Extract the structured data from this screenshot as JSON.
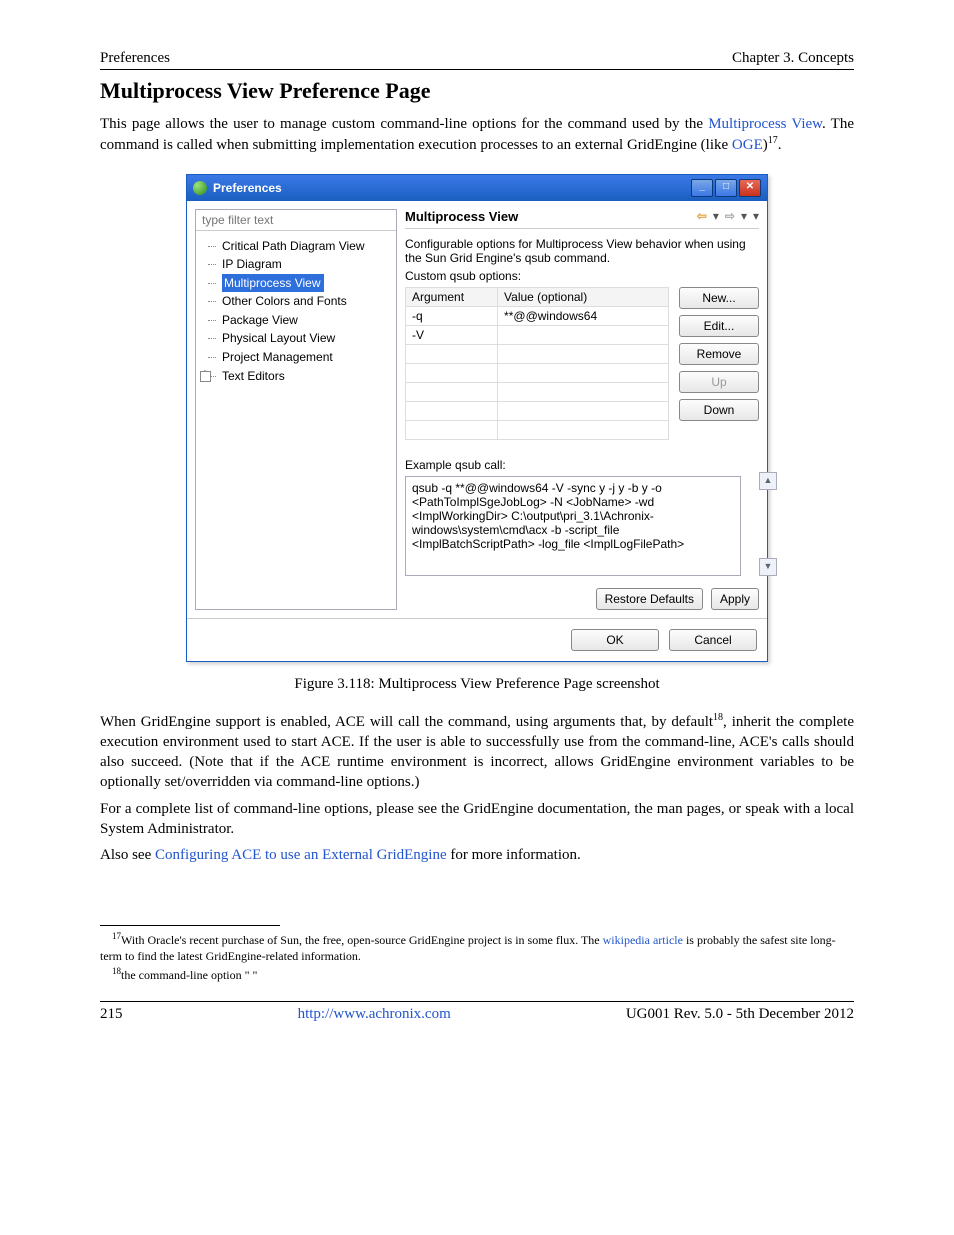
{
  "header": {
    "left": "Preferences",
    "right": "Chapter 3. Concepts"
  },
  "section_title": "Multiprocess View Preference Page",
  "intro": {
    "part1a": "This page allows the user to manage custom command-line options for the ",
    "part1b": " command used by the ",
    "link_mpv": "Multiprocess View",
    "part2a": ". The ",
    "part2b": " command is called when submitting implementation execution processes to an external GridEngine (like ",
    "link_oge": "OGE",
    "part3": ")",
    "sup17": "17",
    "period": "."
  },
  "dialog": {
    "title": "Preferences",
    "filter_placeholder": "type filter text",
    "tree": {
      "item0": "Critical Path Diagram View",
      "item1": "IP Diagram",
      "item2": "Multiprocess View",
      "item3": "Other Colors and Fonts",
      "item4": "Package View",
      "item5": "Physical Layout View",
      "item6": "Project Management",
      "item7": "Text Editors"
    },
    "right": {
      "title": "Multiprocess View",
      "desc": "Configurable options for Multiprocess View behavior when using the Sun Grid Engine's qsub command.",
      "custom_label": "Custom qsub options:",
      "col_arg": "Argument",
      "col_val": "Value (optional)",
      "row0_arg": "-q",
      "row0_val": "**@@windows64",
      "row1_arg": "-V",
      "row1_val": "",
      "btn_new": "New...",
      "btn_edit": "Edit...",
      "btn_remove": "Remove",
      "btn_up": "Up",
      "btn_down": "Down",
      "example_label": "Example qsub call:",
      "example_text": "qsub -q **@@windows64 -V -sync y -j y -b y -o <PathToImplSgeJobLog> -N <JobName> -wd <ImplWorkingDir> C:\\output\\pri_3.1\\Achronix-windows\\system\\cmd\\acx -b -script_file <ImplBatchScriptPath> -log_file <ImplLogFilePath>",
      "btn_restore": "Restore Defaults",
      "btn_apply": "Apply",
      "btn_ok": "OK",
      "btn_cancel": "Cancel"
    }
  },
  "caption": "Figure 3.118: Multiprocess View Preference Page screenshot",
  "para2": {
    "a": "When GridEngine support is enabled, ACE will call the ",
    "b": " command, using arguments that, by default",
    "sup18": "18",
    "c": ", inherit the complete execution environment used to start ACE. If the user is able to successfully use ",
    "d": " from the command-line, ACE's ",
    "e": " calls should also succeed. (Note that if the ACE runtime environment is incorrect, ",
    "f": " allows GridEngine environment variables to be optionally set/overridden via command-line options.)"
  },
  "para3": {
    "a": "For a complete list of ",
    "b": " command-line options, please see the GridEngine documentation, the ",
    "c": " man pages, or speak with a local System Administrator."
  },
  "para4": {
    "a": "Also see ",
    "link": "Configuring ACE to use an External GridEngine",
    "b": " for more information."
  },
  "footnotes": {
    "f17a": "With Oracle's recent purchase of Sun, the free, open-source GridEngine project is in some flux. The ",
    "f17link": "wikipedia article",
    "f17b": " is probably the safest site long-term to find the latest GridEngine-related information.",
    "f18": "the command-line option \"    \""
  },
  "footer": {
    "page": "215",
    "url": "http://www.achronix.com",
    "rev": "UG001 Rev. 5.0 - 5th December 2012"
  }
}
